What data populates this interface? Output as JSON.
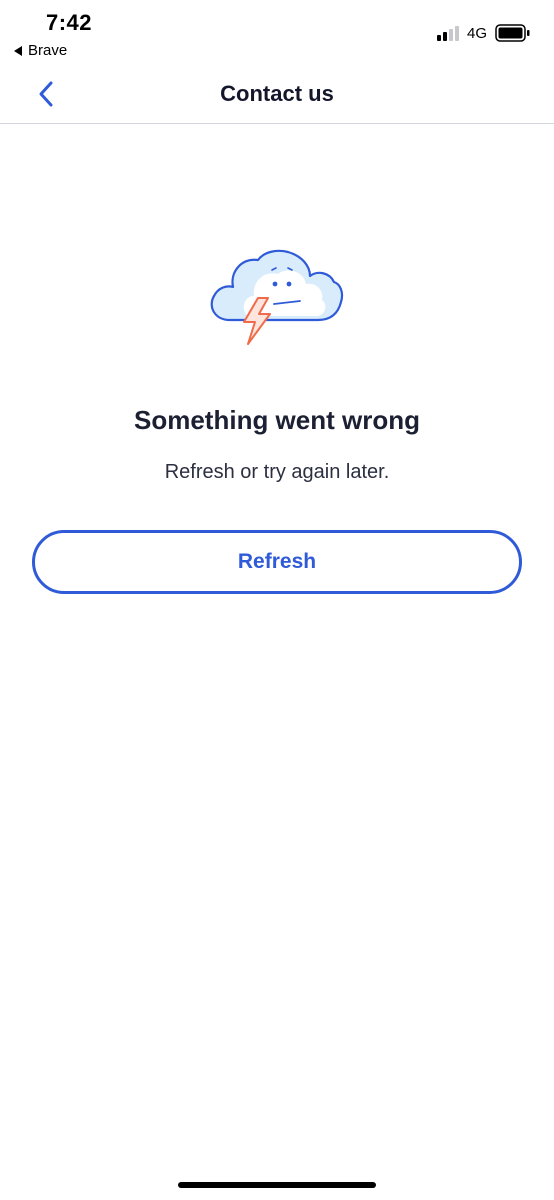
{
  "status_bar": {
    "time": "7:42",
    "back_app": "Brave",
    "network": "4G"
  },
  "nav": {
    "title": "Contact us",
    "back_icon": "chevron-left-icon"
  },
  "error": {
    "illustration_icon": "sad-cloud-lightning-icon",
    "title": "Something went wrong",
    "subtitle": "Refresh or try again later.",
    "refresh_label": "Refresh"
  },
  "colors": {
    "accent": "#2f5ad8",
    "text": "#14172b",
    "cloud_fill": "#d9ecfb",
    "lightning": "#ef6b4a"
  }
}
